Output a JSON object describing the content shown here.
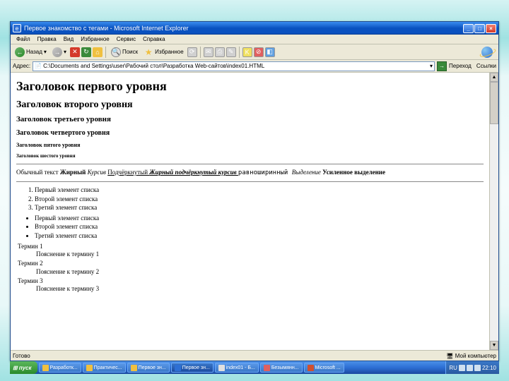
{
  "window": {
    "title": "Первое знакомство с тегами - Microsoft Internet Explorer"
  },
  "menu": {
    "file": "Файл",
    "edit": "Правка",
    "view": "Вид",
    "favorites": "Избранное",
    "tools": "Сервис",
    "help": "Справка"
  },
  "toolbar": {
    "back": "Назад",
    "search": "Поиск",
    "favorites": "Избранное"
  },
  "address": {
    "label": "Адрес:",
    "value": "C:\\Documents and Settings\\user\\Рабочий стол\\Разработка Web-сайтов\\index01.HTML",
    "go": "Переход",
    "links": "Ссылки"
  },
  "page": {
    "h1": "Заголовок первого уровня",
    "h2": "Заголовок второго уровня",
    "h3": "Заголовок третьего уровня",
    "h4": "Заголовок четвертого уровня",
    "h5": "Заголовок пятого уровня",
    "h6": "Заголовок шестого уровня",
    "text_plain": "Обычный текст ",
    "text_bold": "Жирный ",
    "text_italic": "Курсив ",
    "text_under": "Подчёркнутый ",
    "text_biu": "Жирный подчёркнутый курсив ",
    "text_fixed": "равноширинный ",
    "text_em": "Выделение ",
    "text_strong": "Усиленное выделение",
    "ol": [
      "Первый элемент списка",
      "Второй элемент списка",
      "Третий элемент списка"
    ],
    "ul": [
      "Первый элемент списка",
      "Второй элемент списка",
      "Третий элемент списка"
    ],
    "dl": [
      {
        "t": "Термин 1",
        "d": "Пояснение к термину 1"
      },
      {
        "t": "Термин 2",
        "d": "Пояснение к термину 2"
      },
      {
        "t": "Термин 3",
        "d": "Пояснение к термину 3"
      }
    ]
  },
  "status": {
    "left": "Готово",
    "right": "Мой компьютер"
  },
  "taskbar": {
    "start": "пуск",
    "items": [
      "Разработк...",
      "Практичес...",
      "Первое зн...",
      "Первое зн...",
      "index01 - Б...",
      "Безымянн...",
      "Microsoft ..."
    ],
    "lang": "RU",
    "time": "22:10"
  }
}
